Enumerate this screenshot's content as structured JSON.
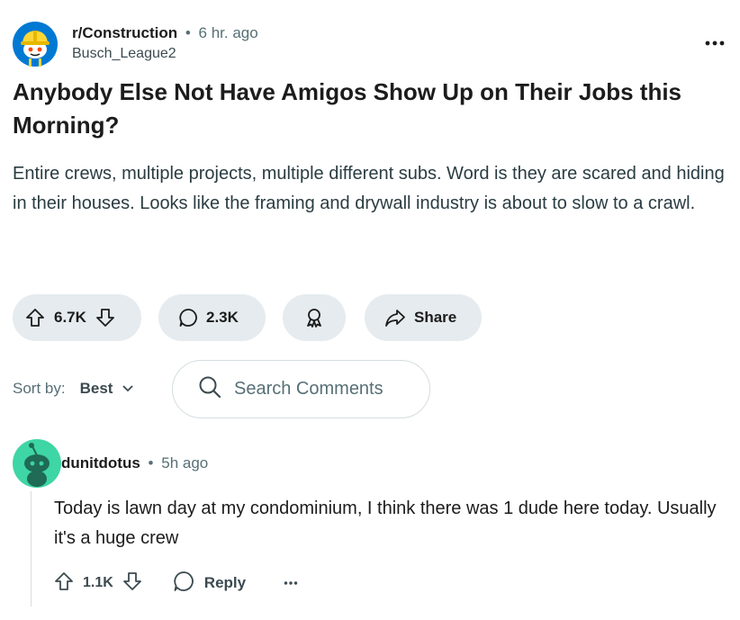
{
  "post": {
    "subreddit": "r/Construction",
    "separator": "•",
    "time_ago": "6 hr. ago",
    "author": "Busch_League2",
    "title": "Anybody Else Not Have Amigos Show Up on Their Jobs this Morning?",
    "body": "Entire crews, multiple projects, multiple different subs. Word is they are scared and hiding in their houses. Looks like the framing and drywall industry is about to slow to a crawl.",
    "upvotes": "6.7K",
    "comments": "2.3K",
    "share_label": "Share"
  },
  "sort": {
    "label": "Sort by:",
    "value": "Best"
  },
  "search": {
    "placeholder": "Search Comments"
  },
  "comment": {
    "author": "dunitdotus",
    "separator": "•",
    "time_ago": "5h ago",
    "body": "Today is lawn day at my condominium, I think there was 1 dude here today. Usually it's a huge crew",
    "upvotes": "1.1K",
    "reply_label": "Reply"
  },
  "colors": {
    "pill_bg": "#e5ebee",
    "subreddit_icon_bg": "#0079d3",
    "hardhat": "#ffd635",
    "comment_avatar": "#3ed6a4"
  },
  "icons": [
    "hardhat-snoo-icon",
    "more-icon",
    "upvote-icon",
    "downvote-icon",
    "comment-icon",
    "award-icon",
    "share-icon",
    "chevron-down-icon",
    "search-icon",
    "snoo-avatar-icon",
    "reply-icon"
  ]
}
